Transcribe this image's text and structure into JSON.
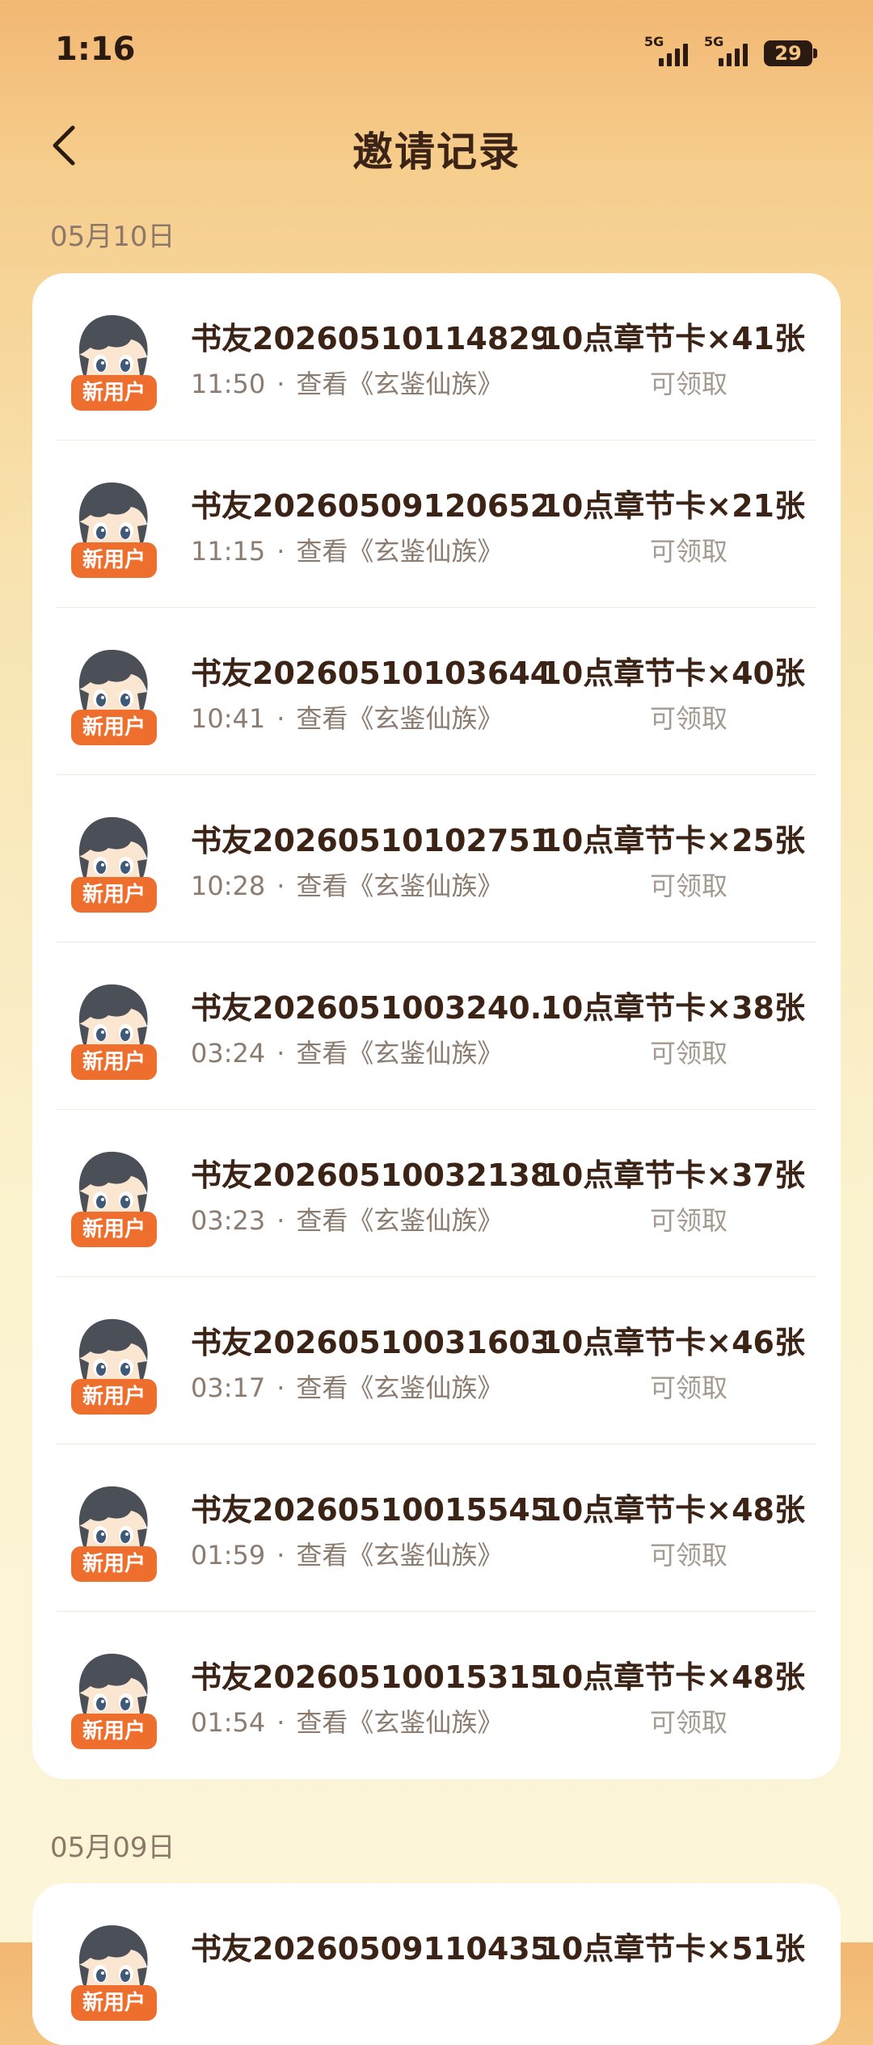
{
  "status_bar": {
    "time": "1:16",
    "signal1_label": "5G",
    "signal2_label": "5G",
    "battery": "29"
  },
  "header": {
    "title": "邀请记录"
  },
  "sections": [
    {
      "date": "05月10日",
      "records": [
        {
          "name": "书友20260510114829...",
          "time": "11:50",
          "action": "查看《玄鉴仙族》",
          "reward": "10点章节卡×41张",
          "status": "可领取",
          "badge": "新用户"
        },
        {
          "name": "书友20260509120652...",
          "time": "11:15",
          "action": "查看《玄鉴仙族》",
          "reward": "10点章节卡×21张",
          "status": "可领取",
          "badge": "新用户"
        },
        {
          "name": "书友20260510103644...",
          "time": "10:41",
          "action": "查看《玄鉴仙族》",
          "reward": "10点章节卡×40张",
          "status": "可领取",
          "badge": "新用户"
        },
        {
          "name": "书友20260510102751...",
          "time": "10:28",
          "action": "查看《玄鉴仙族》",
          "reward": "10点章节卡×25张",
          "status": "可领取",
          "badge": "新用户"
        },
        {
          "name": "书友2026051003240...",
          "time": "03:24",
          "action": "查看《玄鉴仙族》",
          "reward": "10点章节卡×38张",
          "status": "可领取",
          "badge": "新用户"
        },
        {
          "name": "书友20260510032138...",
          "time": "03:23",
          "action": "查看《玄鉴仙族》",
          "reward": "10点章节卡×37张",
          "status": "可领取",
          "badge": "新用户"
        },
        {
          "name": "书友20260510031603...",
          "time": "03:17",
          "action": "查看《玄鉴仙族》",
          "reward": "10点章节卡×46张",
          "status": "可领取",
          "badge": "新用户"
        },
        {
          "name": "书友20260510015545...",
          "time": "01:59",
          "action": "查看《玄鉴仙族》",
          "reward": "10点章节卡×48张",
          "status": "可领取",
          "badge": "新用户"
        },
        {
          "name": "书友20260510015315...",
          "time": "01:54",
          "action": "查看《玄鉴仙族》",
          "reward": "10点章节卡×48张",
          "status": "可领取",
          "badge": "新用户"
        }
      ]
    },
    {
      "date": "05月09日",
      "records": [
        {
          "name": "书友20260509110435...",
          "time": "",
          "action": "",
          "reward": "10点章节卡×51张",
          "status": "",
          "badge": "新用户"
        }
      ]
    }
  ],
  "separator": "·",
  "colors": {
    "accent": "#ee6e2d",
    "title_text": "#3b2316",
    "sub_text": "#8c7c70"
  }
}
